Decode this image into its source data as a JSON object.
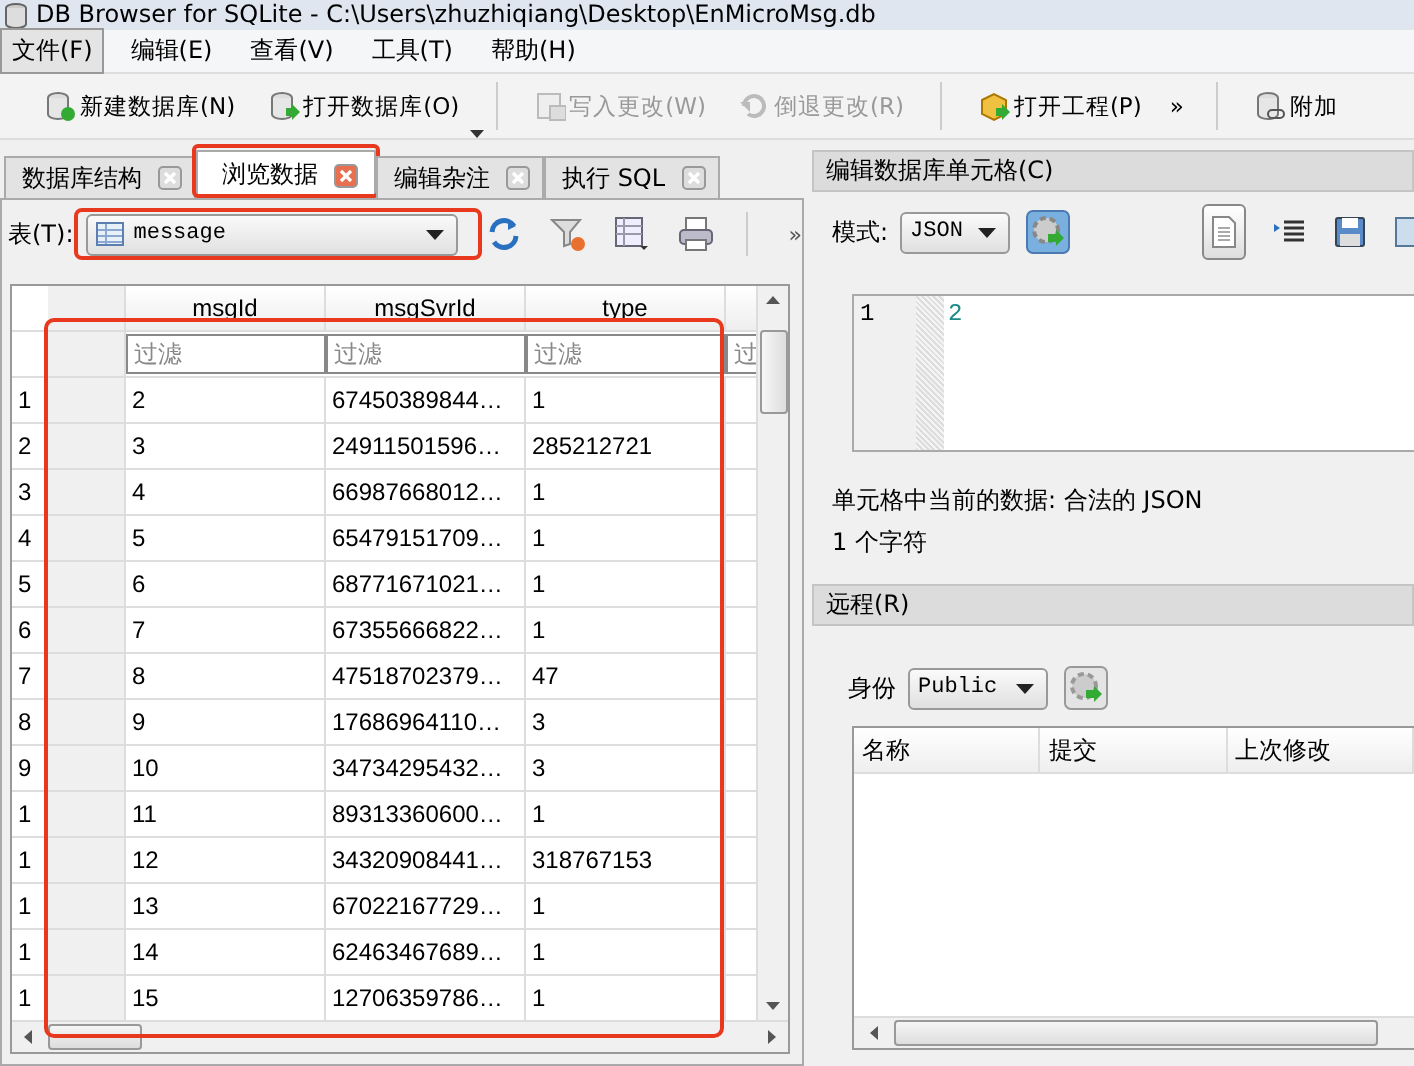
{
  "window": {
    "title": "DB Browser for SQLite - C:\\Users\\zhuzhiqiang\\Desktop\\EnMicroMsg.db"
  },
  "menu": [
    {
      "label": "文件(F)",
      "selected": true
    },
    {
      "label": "编辑(E)",
      "selected": false
    },
    {
      "label": "查看(V)",
      "selected": false
    },
    {
      "label": "工具(T)",
      "selected": false
    },
    {
      "label": "帮助(H)",
      "selected": false
    }
  ],
  "toolbar": [
    {
      "kind": "new",
      "label": "新建数据库(N)",
      "disabled": false
    },
    {
      "kind": "open",
      "label": "打开数据库(O)",
      "disabled": false
    },
    {
      "kind": "write",
      "label": "写入更改(W)",
      "disabled": true
    },
    {
      "kind": "revert",
      "label": "倒退更改(R)",
      "disabled": true
    },
    {
      "kind": "project",
      "label": "打开工程(P)",
      "disabled": false
    },
    {
      "kind": "more",
      "label": "»",
      "disabled": false
    },
    {
      "kind": "attach",
      "label": "附加",
      "disabled": false
    }
  ],
  "tabs": [
    {
      "label": "数据库结构",
      "selected": false
    },
    {
      "label": "浏览数据",
      "selected": true
    },
    {
      "label": "编辑杂注",
      "selected": false
    },
    {
      "label": "执行 SQL",
      "selected": false
    }
  ],
  "table_selector": {
    "label": "表(T):",
    "value": "message",
    "overflow": "»"
  },
  "grid": {
    "columns": [
      {
        "name": "msgId",
        "filter": "过滤"
      },
      {
        "name": "msgSvrId",
        "filter": "过滤"
      },
      {
        "name": "type",
        "filter": "过滤"
      },
      {
        "filter": "过"
      }
    ],
    "rows": [
      {
        "number": "1",
        "cells": [
          "2",
          "67450389844…",
          "1"
        ]
      },
      {
        "number": "2",
        "cells": [
          "3",
          "24911501596…",
          "285212721"
        ]
      },
      {
        "number": "3",
        "cells": [
          "4",
          "66987668012…",
          "1"
        ]
      },
      {
        "number": "4",
        "cells": [
          "5",
          "65479151709…",
          "1"
        ]
      },
      {
        "number": "5",
        "cells": [
          "6",
          "68771671021…",
          "1"
        ]
      },
      {
        "number": "6",
        "cells": [
          "7",
          "67355666822…",
          "1"
        ]
      },
      {
        "number": "7",
        "cells": [
          "8",
          "47518702379…",
          "47"
        ]
      },
      {
        "number": "8",
        "cells": [
          "9",
          "17686964110…",
          "3"
        ]
      },
      {
        "number": "9",
        "cells": [
          "10",
          "34734295432…",
          "3"
        ]
      },
      {
        "number": "1",
        "cells": [
          "11",
          "89313360600…",
          "1"
        ]
      },
      {
        "number": "1",
        "cells": [
          "12",
          "34320908441…",
          "318767153"
        ]
      },
      {
        "number": "1",
        "cells": [
          "13",
          "67022167729…",
          "1"
        ]
      },
      {
        "number": "1",
        "cells": [
          "14",
          "62463467689…",
          "1"
        ]
      },
      {
        "number": "1",
        "cells": [
          "15",
          "12706359786…",
          "1"
        ]
      }
    ]
  },
  "cell_editor": {
    "title": "编辑数据库单元格(C)",
    "mode_label": "模式:",
    "mode": "JSON",
    "line_number": "1",
    "content": "2",
    "status": "单元格中当前的数据: 合法的 JSON",
    "size": "1 个字符"
  },
  "remote": {
    "title": "远程(R)",
    "identity_label": "身份",
    "identity": "Public",
    "columns": [
      "名称",
      "提交",
      "上次修改"
    ]
  }
}
